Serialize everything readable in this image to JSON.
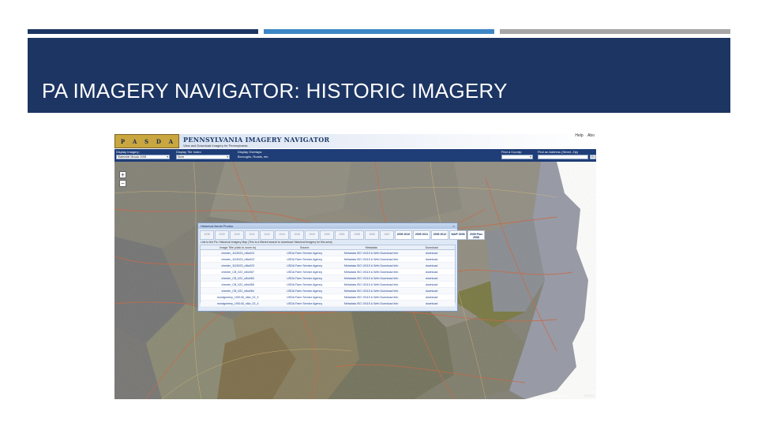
{
  "slide": {
    "title": "PA IMAGERY NAVIGATOR: HISTORIC IMAGERY"
  },
  "app": {
    "logo_letters": [
      "P",
      "A",
      "S",
      "D",
      "A"
    ],
    "title": "PENNSYLVANIA IMAGERY NAVIGATOR",
    "subtitle": "View and Download Imagery for Pennsylvania",
    "top_links": [
      "Help",
      "Abo"
    ]
  },
  "toolbar": {
    "display_imagery": {
      "label": "Display Imagery:",
      "value": "Statewide Mosaic 2008"
    },
    "tile_index": {
      "label": "Display Tile Index:",
      "value": "None"
    },
    "overlays": {
      "label": "Display Overlays:",
      "value": "Boroughs, Roads, etc"
    },
    "find_county": {
      "label": "Find a County:",
      "value": ""
    },
    "find_address": {
      "label": "Find an Address (Street, Zip)",
      "value": ""
    },
    "go": "Ex"
  },
  "map": {
    "zoom_in": "+",
    "zoom_out": "−",
    "footer": "Pennsylvania",
    "footer2": "PASDA"
  },
  "popup": {
    "title": "Historical Aerial Photos",
    "years": [
      {
        "label": "1938",
        "on": false
      },
      {
        "label": "1939",
        "on": false
      },
      {
        "label": "1940",
        "on": false
      },
      {
        "label": "1941",
        "on": false
      },
      {
        "label": "1942",
        "on": false
      },
      {
        "label": "1944",
        "on": false
      },
      {
        "label": "1946",
        "on": false
      },
      {
        "label": "1949",
        "on": false
      },
      {
        "label": "1950",
        "on": false
      },
      {
        "label": "1951",
        "on": false
      },
      {
        "label": "1958",
        "on": false
      },
      {
        "label": "1965",
        "on": false
      },
      {
        "label": "1967",
        "on": false
      },
      {
        "label": "2005 2010",
        "on": true
      },
      {
        "label": "2005 2011",
        "on": true
      },
      {
        "label": "2005 2012",
        "on": true
      },
      {
        "label": "NAIP 2008",
        "on": true
      },
      {
        "label": "2009 Plus 2008",
        "on": true
      }
    ],
    "note": "Link to the Pa. Historical Imagery Map (This is a filtered search to download Historical Imagery for this area)",
    "columns": [
      "Image Title (click to zoom to)",
      "Source",
      "Metadata",
      "Download"
    ],
    "rows": [
      [
        "chester_1115023_n8w024",
        "USDA Farm Service Agency",
        "Metadata ISO 19115 & Web Download Info",
        "download"
      ],
      [
        "chester_1115023_n8w022",
        "USDA Farm Service Agency",
        "Metadata ISO 19115 & Web Download Info",
        "download"
      ],
      [
        "chester_1115023_n8w023",
        "USDA Farm Service Agency",
        "Metadata ISO 19115 & Web Download Info",
        "download"
      ],
      [
        "chester_CB_022_n8w067",
        "USDA Farm Service Agency",
        "Metadata ISO 19115 & Web Download Info",
        "download"
      ],
      [
        "chester_CB_022_n8w063",
        "USDA Farm Service Agency",
        "Metadata ISO 19115 & Web Download Info",
        "download"
      ],
      [
        "chester_CB_022_n8w065",
        "USDA Farm Service Agency",
        "Metadata ISO 19115 & Web Download Info",
        "download"
      ],
      [
        "chester_CB_022_n8w064",
        "USDA Farm Service Agency",
        "Metadata ISO 19115 & Web Download Info",
        "download"
      ],
      [
        "montgomery_190140_n8w_02_3",
        "USDA Farm Service Agency",
        "Metadata ISO 19115 & Web Download Info",
        "download"
      ],
      [
        "montgomery_190140_n8w_02_4",
        "USDA Farm Service Agency",
        "Metadata ISO 19115 & Web Download Info",
        "download"
      ]
    ]
  }
}
